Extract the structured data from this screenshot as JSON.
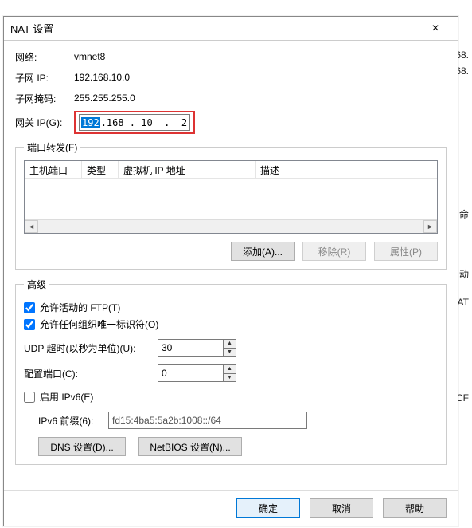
{
  "dialog": {
    "title": "NAT 设置",
    "close_label": "×"
  },
  "info": {
    "network_label": "网络:",
    "network_value": "vmnet8",
    "subnet_ip_label": "子网 IP:",
    "subnet_ip_value": "192.168.10.0",
    "subnet_mask_label": "子网掩码:",
    "subnet_mask_value": "255.255.255.0",
    "gateway_label": "网关 IP(G):",
    "gateway_sel": "192",
    "gateway_rest": ".168 . 10  .  2"
  },
  "portfwd": {
    "legend": "端口转发(F)",
    "col_hostport": "主机端口",
    "col_type": "类型",
    "col_vm_ip": "虚拟机 IP 地址",
    "col_desc": "描述",
    "btn_add": "添加(A)...",
    "btn_remove": "移除(R)",
    "btn_props": "属性(P)"
  },
  "advanced": {
    "legend": "高级",
    "allow_ftp_label": "允许活动的 FTP(T)",
    "allow_ftp_checked": true,
    "allow_oui_label": "允许任何组织唯一标识符(O)",
    "allow_oui_checked": true,
    "udp_timeout_label": "UDP 超时(以秒为单位)(U):",
    "udp_timeout_value": "30",
    "config_port_label": "配置端口(C):",
    "config_port_value": "0",
    "enable_ipv6_label": "启用 IPv6(E)",
    "enable_ipv6_checked": false,
    "ipv6_prefix_label": "IPv6 前缀(6):",
    "ipv6_prefix_value": "fd15:4ba5:5a2b:1008::/64",
    "btn_dns": "DNS 设置(D)...",
    "btn_netbios": "NetBIOS 设置(N)..."
  },
  "footer": {
    "ok": "确定",
    "cancel": "取消",
    "help": "帮助"
  },
  "bg": {
    "frag1": "68.",
    "frag2": "68.",
    "frag3": "命",
    "frag4": "动",
    "frag5": "AT ",
    "frag6": "ICF"
  }
}
